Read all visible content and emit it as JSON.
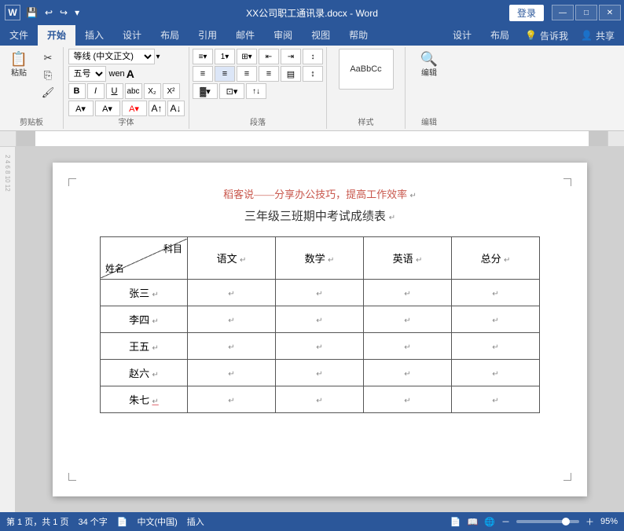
{
  "titlebar": {
    "title": "XX公司职工通讯录.docx - Word",
    "app": "Word",
    "login_label": "登录",
    "minimize": "—",
    "restore": "□",
    "close": "✕"
  },
  "ribbon": {
    "tabs": [
      "文件",
      "开始",
      "插入",
      "设计",
      "布局",
      "引用",
      "邮件",
      "审阅",
      "视图",
      "帮助"
    ],
    "active_tab": "开始",
    "right_tabs": [
      "设计",
      "布局"
    ],
    "tell_me": "告诉我",
    "share": "共享",
    "groups": {
      "clipboard": "剪贴板",
      "font": "字体",
      "paragraph": "段落",
      "styles": "样式",
      "edit": "编辑"
    },
    "font_name": "等线 (中文正文)",
    "font_size": "五号",
    "paste_label": "粘贴",
    "styles_label": "样式",
    "edit_label": "编辑"
  },
  "ruler": {
    "visible": true
  },
  "document": {
    "subtitle": "稻客说——分享办公技巧，提高工作效率",
    "title": "三年级三班期中考试成绩表",
    "table": {
      "headers": {
        "subject": "科目",
        "name": "姓名",
        "chinese": "语文",
        "math": "数学",
        "english": "英语",
        "total": "总分"
      },
      "rows": [
        {
          "name": "张三"
        },
        {
          "name": "李四"
        },
        {
          "name": "王五"
        },
        {
          "name": "赵六"
        },
        {
          "name": "朱七"
        }
      ]
    }
  },
  "statusbar": {
    "page_info": "第 1 页，共 1 页",
    "word_count": "34 个字",
    "language": "中文(中国)",
    "mode": "插入",
    "zoom": "95%"
  }
}
